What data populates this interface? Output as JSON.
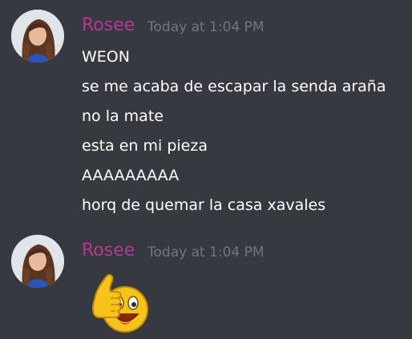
{
  "messages": [
    {
      "author": "Rosee",
      "timestamp": "Today at 1:04 PM",
      "lines": [
        "WEON",
        "se me acaba de escapar la senda araña",
        "no la mate",
        "esta en mi pieza",
        "AAAAAAAAA",
        "horq de quemar la casa xavales"
      ]
    },
    {
      "author": "Rosee",
      "timestamp": "Today at 1:04 PM",
      "emoji": "thumbs-up-smiley-icon"
    }
  ],
  "colors": {
    "background": "#36393f",
    "username": "#b6378f",
    "timestamp": "#72767d",
    "text": "#ffffff"
  }
}
